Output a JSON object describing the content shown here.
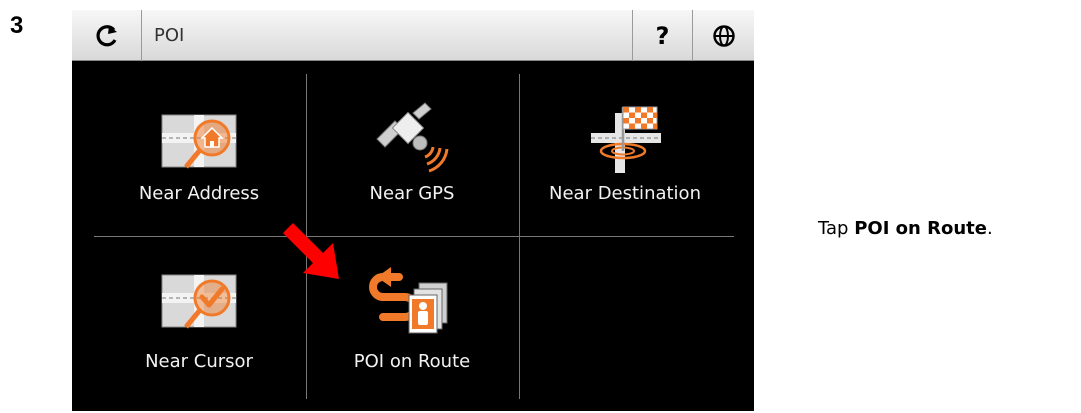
{
  "step": "3",
  "header": {
    "title": "POI",
    "help_label": "?",
    "back_icon": "refresh-back-icon",
    "globe_icon": "globe-icon"
  },
  "menu": {
    "items": [
      {
        "label": "Near Address",
        "icon": "map-house-icon"
      },
      {
        "label": "Near GPS",
        "icon": "satellite-icon"
      },
      {
        "label": "Near Destination",
        "icon": "checkered-flag-icon"
      },
      {
        "label": "Near Cursor",
        "icon": "map-checkmark-icon"
      },
      {
        "label": "POI on Route",
        "icon": "route-poi-icon"
      }
    ]
  },
  "instruction": {
    "prefix": "Tap ",
    "emphasis": "POI on Route",
    "suffix": "."
  },
  "colors": {
    "accent": "#f07a2a",
    "pointer": "#ff0000"
  }
}
